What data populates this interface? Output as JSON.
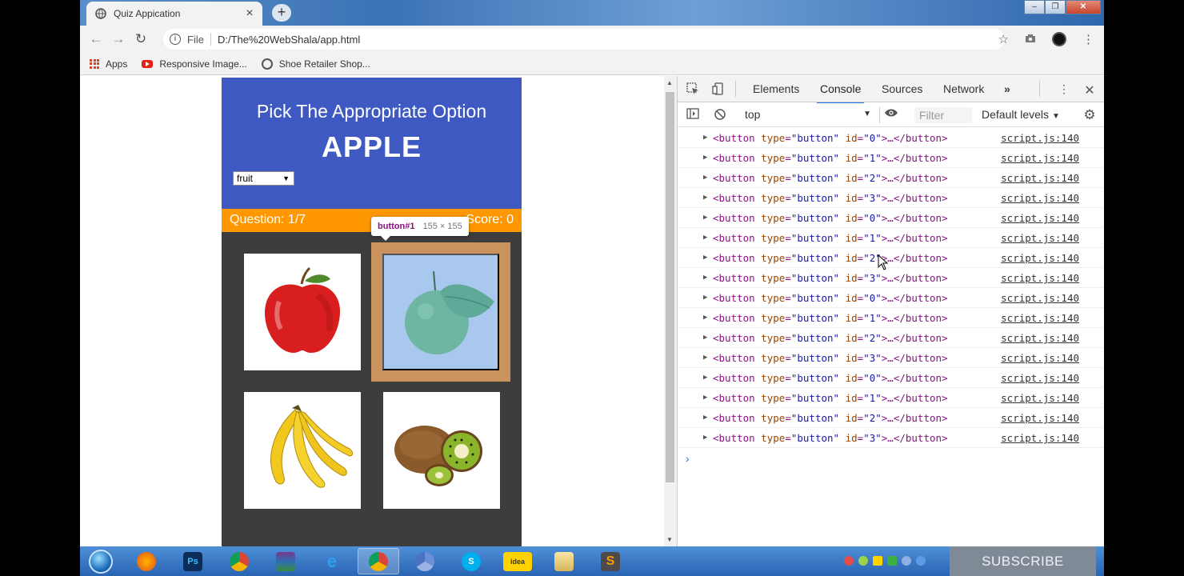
{
  "browser": {
    "tab_title": "Quiz Appication",
    "tab_close": "×",
    "new_tab": "+",
    "url_scheme": "File",
    "url": "D:/The%20WebShala/app.html",
    "window_controls": [
      "–",
      "❐",
      "✕"
    ]
  },
  "bookmarks": [
    {
      "label": "Apps",
      "icon": "apps-grid-icon"
    },
    {
      "label": "Responsive Image...",
      "icon": "youtube-icon"
    },
    {
      "label": "Shoe Retailer Shop...",
      "icon": "globe-icon"
    }
  ],
  "quiz": {
    "heading": "Pick The Appropriate Option",
    "word": "APPLE",
    "category_select": "fruit",
    "question_label": "Question: 1/7",
    "score_label": "Score: 0",
    "options": [
      {
        "id": "0",
        "image": "apple"
      },
      {
        "id": "1",
        "image": "orange"
      },
      {
        "id": "2",
        "image": "banana"
      },
      {
        "id": "3",
        "image": "kiwi"
      }
    ]
  },
  "inspector_tooltip": {
    "tag": "button#1",
    "dims": "155 × 155"
  },
  "devtools": {
    "tabs": [
      "Elements",
      "Console",
      "Sources",
      "Network"
    ],
    "active_tab": "Console",
    "more": "»",
    "context": "top",
    "filter_placeholder": "Filter",
    "levels": "Default levels",
    "log_source": "script.js:140",
    "log_ids": [
      "0",
      "1",
      "2",
      "3",
      "0",
      "1",
      "2",
      "3",
      "0",
      "1",
      "2",
      "3",
      "0",
      "1",
      "2",
      "3"
    ],
    "prompt": "›"
  },
  "taskbar": {
    "subscribe": "SUBSCRIBE"
  }
}
